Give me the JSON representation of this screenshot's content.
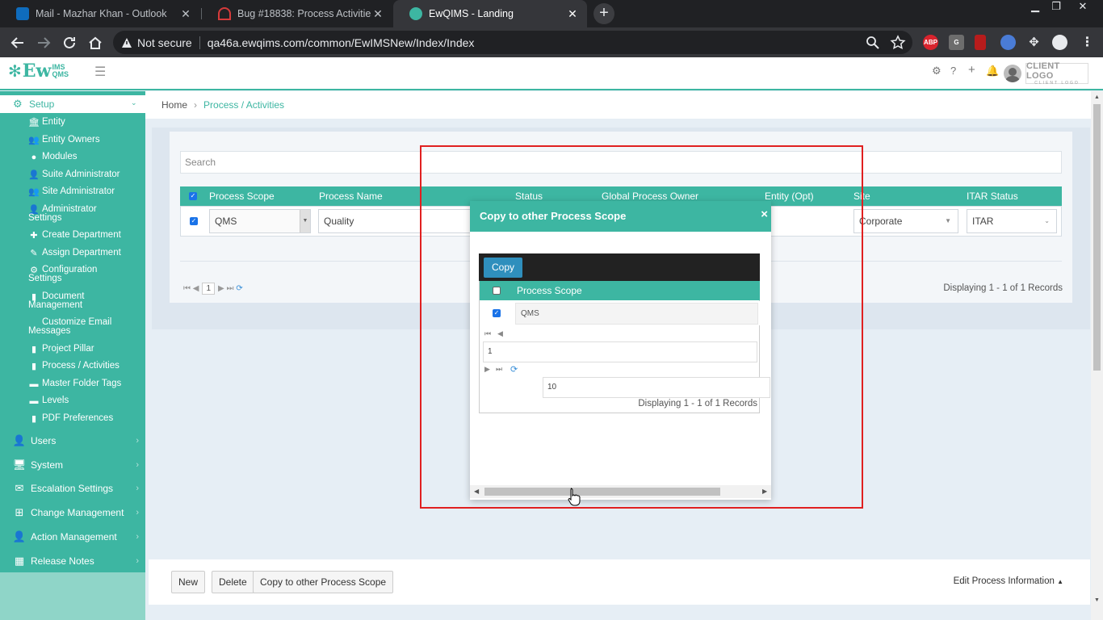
{
  "browser": {
    "tabs": [
      {
        "title": "Mail - Mazhar Khan - Outlook",
        "icon_color": "#0f6cbd",
        "active": false
      },
      {
        "title": "Bug #18838: Process Activities->",
        "icon_color": "#d63b3b",
        "active": false
      },
      {
        "title": "EwQIMS - Landing",
        "icon_color": "#3db6a2",
        "active": true
      }
    ],
    "security_label": "Not secure",
    "url": "qa46a.ewqims.com/common/EwIMSNew/Index/Index",
    "extensions": [
      "ABP",
      "G"
    ]
  },
  "app": {
    "logo_text": "Ew",
    "logo_sup_top": "IMS",
    "logo_sup_bottom": "QMS",
    "client_logo_line1": "CLIENT LOGO",
    "client_logo_line2": "CLIENT LOGO",
    "accent_color": "#3db6a2"
  },
  "sidebar": {
    "setup_label": "Setup",
    "items": [
      {
        "label": "Entity",
        "icon": "bank-icon"
      },
      {
        "label": "Entity Owners",
        "icon": "users-icon"
      },
      {
        "label": "Modules",
        "icon": "globe-icon"
      },
      {
        "label": "Suite Administrator",
        "icon": "user-icon"
      },
      {
        "label": "Site Administrator",
        "icon": "users-icon"
      },
      {
        "label": "Administrator",
        "label2": "Settings",
        "icon": "user-gear-icon"
      },
      {
        "label": "Create Department",
        "icon": "plus-icon"
      },
      {
        "label": "Assign Department",
        "icon": "pencil-icon"
      },
      {
        "label": "Configuration",
        "label2": "Settings",
        "icon": "gear-icon"
      },
      {
        "label": "Document",
        "label2": "Management",
        "icon": "document-icon"
      },
      {
        "label": "Customize Email",
        "label2": "Messages",
        "icon": ""
      },
      {
        "label": "Project Pillar",
        "icon": "document-icon"
      },
      {
        "label": "Process / Activities",
        "icon": "document-icon"
      },
      {
        "label": "Master Folder Tags",
        "icon": "folder-icon"
      },
      {
        "label": "Levels",
        "icon": "folder-icon"
      },
      {
        "label": "PDF Preferences",
        "icon": "document-icon"
      }
    ],
    "main_items": [
      {
        "label": "Users",
        "icon": "user-icon"
      },
      {
        "label": "System",
        "icon": "monitor-icon"
      },
      {
        "label": "Escalation Settings",
        "icon": "envelope-icon"
      },
      {
        "label": "Change Management",
        "icon": "sitemap-icon"
      },
      {
        "label": "Action Management",
        "icon": "user-check-icon"
      },
      {
        "label": "Release Notes",
        "icon": "building-icon"
      }
    ]
  },
  "breadcrumb": {
    "home": "Home",
    "current": "Process / Activities"
  },
  "grid": {
    "search_placeholder": "Search",
    "columns": [
      "Process Scope",
      "Process Name",
      "Status",
      "Global Process Owner",
      "Entity (Opt)",
      "Site",
      "ITAR Status"
    ],
    "row": {
      "process_scope": "QMS",
      "process_name": "Quality",
      "site": "Corporate",
      "itar_status": "ITAR"
    },
    "page": "1",
    "displaying": "Displaying 1 - 1 of 1 Records"
  },
  "footer": {
    "new_label": "New",
    "delete_label": "Delete",
    "copy_label": "Copy to other Process Scope",
    "edit_info_label": "Edit Process Information"
  },
  "modal": {
    "title": "Copy to other Process Scope",
    "close_label": "×",
    "copy_button": "Copy",
    "column": "Process Scope",
    "row_value": "QMS",
    "page": "1",
    "page_size": "10",
    "displaying": "Displaying 1 - 1 of 1 Records"
  }
}
